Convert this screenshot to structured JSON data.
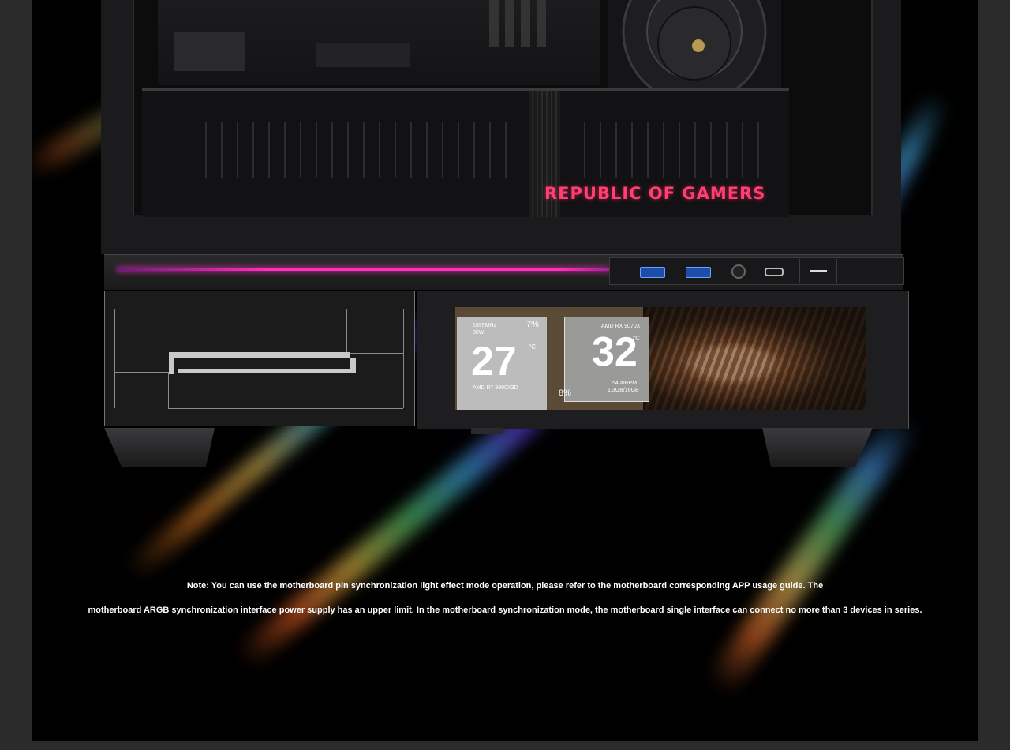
{
  "gpu_branding": "REPUBLIC OF GAMERS",
  "lcd": {
    "cpu": {
      "freq": "1899MHz",
      "power": "35W",
      "usage": "7%",
      "temp": "27",
      "unit": "°C",
      "name": "AMD R7 9800X3D"
    },
    "gpu": {
      "name": "AMD RX 9070XT",
      "temp": "32",
      "unit": "°C",
      "usage": "8%",
      "fan": "5400RPM",
      "vram": "1.3GB/16GB"
    }
  },
  "note": {
    "line1": "Note: You can use the motherboard pin synchronization light effect mode operation, please refer to the motherboard corresponding APP usage guide. The",
    "line2": "motherboard ARGB synchronization interface power supply has an upper limit. In the motherboard synchronization mode, the motherboard single interface can connect no more than 3 devices in series."
  },
  "colors": {
    "rgb_strip": "#ff2fb8",
    "brand_text": "#ff3f6c",
    "usb_port": "#1c4ea8",
    "background": "#000000"
  }
}
